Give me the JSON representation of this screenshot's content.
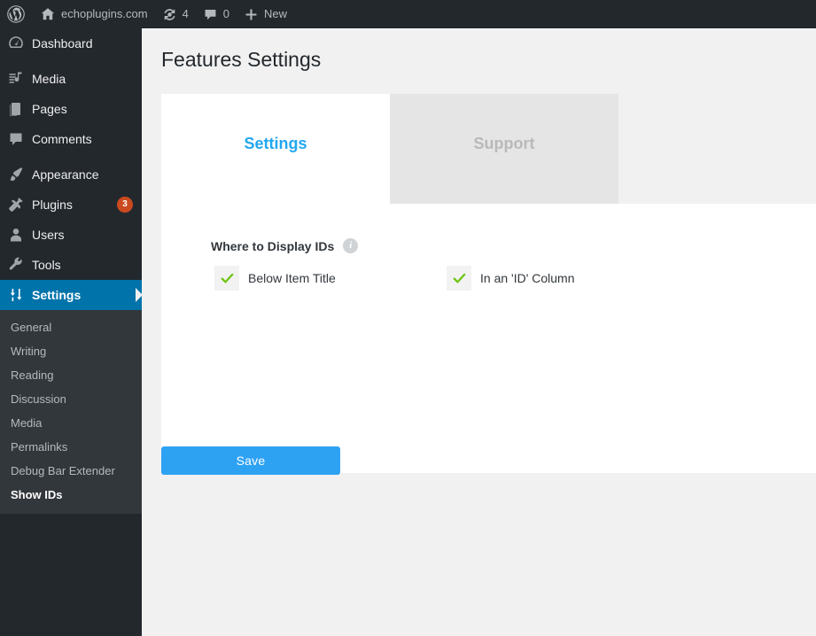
{
  "adminbar": {
    "logo_icon": "wordpress-logo-icon",
    "site_name": "echoplugins.com",
    "site_icon": "home-icon",
    "updates_icon": "updates-icon",
    "updates_count": "4",
    "comments_icon": "comment-bubble-icon",
    "comments_count": "0",
    "new_icon": "plus-icon",
    "new_label": "New"
  },
  "sidebar": {
    "items": [
      {
        "label": "Dashboard",
        "icon": "dashboard-icon",
        "key": "dashboard"
      },
      {
        "label": "Media",
        "icon": "media-icon",
        "key": "media"
      },
      {
        "label": "Pages",
        "icon": "pages-icon",
        "key": "pages"
      },
      {
        "label": "Comments",
        "icon": "comments-icon",
        "key": "comments"
      },
      {
        "label": "Appearance",
        "icon": "appearance-brush-icon",
        "key": "appearance"
      },
      {
        "label": "Plugins",
        "icon": "plugins-plug-icon",
        "key": "plugins",
        "badge": "3"
      },
      {
        "label": "Users",
        "icon": "users-icon",
        "key": "users"
      },
      {
        "label": "Tools",
        "icon": "tools-wrench-icon",
        "key": "tools"
      },
      {
        "label": "Settings",
        "icon": "settings-sliders-icon",
        "key": "settings",
        "current": true
      }
    ],
    "submenu": [
      {
        "label": "General"
      },
      {
        "label": "Writing"
      },
      {
        "label": "Reading"
      },
      {
        "label": "Discussion"
      },
      {
        "label": "Media"
      },
      {
        "label": "Permalinks"
      },
      {
        "label": "Debug Bar Extender"
      },
      {
        "label": "Show IDs",
        "current": true
      }
    ]
  },
  "main": {
    "page_title": "Features Settings",
    "tabs": [
      {
        "label": "Settings",
        "active": true
      },
      {
        "label": "Support",
        "active": false
      }
    ],
    "field": {
      "label": "Where to Display IDs",
      "info_icon": "info-icon",
      "options": [
        {
          "label": "Below Item Title",
          "checked": true,
          "icon": "checkmark-icon"
        },
        {
          "label": "In an 'ID' Column",
          "checked": true,
          "icon": "checkmark-icon"
        }
      ]
    },
    "save_label": "Save"
  },
  "colors": {
    "admin_bar": "#23282d",
    "sidebar": "#23282d",
    "submenu": "#32373c",
    "active_menu": "#0073aa",
    "badge": "#ca4a1f",
    "tab_active_text": "#22a7f0",
    "tab_inactive_bg": "#e5e5e5",
    "save_button": "#2ea2f2",
    "checkmark_green": "#6fc414",
    "page_background": "#f1f1f1"
  }
}
